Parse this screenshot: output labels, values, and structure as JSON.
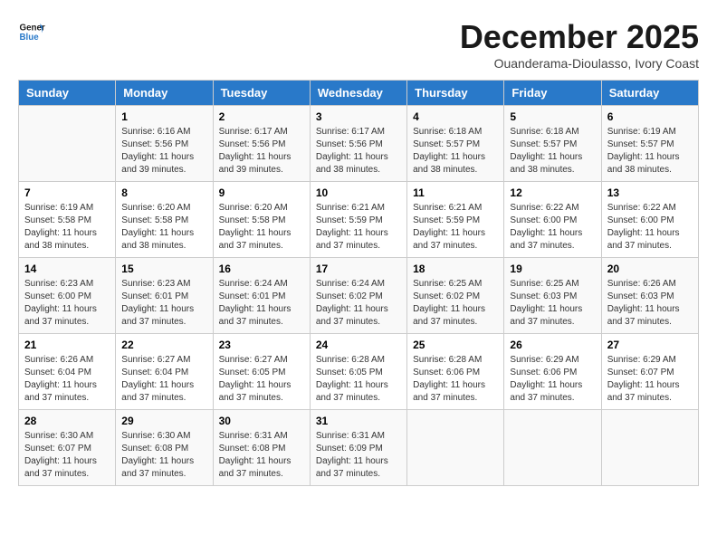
{
  "logo": {
    "line1": "General",
    "line2": "Blue"
  },
  "title": "December 2025",
  "subtitle": "Ouanderama-Dioulasso, Ivory Coast",
  "days_of_week": [
    "Sunday",
    "Monday",
    "Tuesday",
    "Wednesday",
    "Thursday",
    "Friday",
    "Saturday"
  ],
  "weeks": [
    [
      {
        "day": "",
        "info": ""
      },
      {
        "day": "1",
        "info": "Sunrise: 6:16 AM\nSunset: 5:56 PM\nDaylight: 11 hours\nand 39 minutes."
      },
      {
        "day": "2",
        "info": "Sunrise: 6:17 AM\nSunset: 5:56 PM\nDaylight: 11 hours\nand 39 minutes."
      },
      {
        "day": "3",
        "info": "Sunrise: 6:17 AM\nSunset: 5:56 PM\nDaylight: 11 hours\nand 38 minutes."
      },
      {
        "day": "4",
        "info": "Sunrise: 6:18 AM\nSunset: 5:57 PM\nDaylight: 11 hours\nand 38 minutes."
      },
      {
        "day": "5",
        "info": "Sunrise: 6:18 AM\nSunset: 5:57 PM\nDaylight: 11 hours\nand 38 minutes."
      },
      {
        "day": "6",
        "info": "Sunrise: 6:19 AM\nSunset: 5:57 PM\nDaylight: 11 hours\nand 38 minutes."
      }
    ],
    [
      {
        "day": "7",
        "info": "Sunrise: 6:19 AM\nSunset: 5:58 PM\nDaylight: 11 hours\nand 38 minutes."
      },
      {
        "day": "8",
        "info": "Sunrise: 6:20 AM\nSunset: 5:58 PM\nDaylight: 11 hours\nand 38 minutes."
      },
      {
        "day": "9",
        "info": "Sunrise: 6:20 AM\nSunset: 5:58 PM\nDaylight: 11 hours\nand 37 minutes."
      },
      {
        "day": "10",
        "info": "Sunrise: 6:21 AM\nSunset: 5:59 PM\nDaylight: 11 hours\nand 37 minutes."
      },
      {
        "day": "11",
        "info": "Sunrise: 6:21 AM\nSunset: 5:59 PM\nDaylight: 11 hours\nand 37 minutes."
      },
      {
        "day": "12",
        "info": "Sunrise: 6:22 AM\nSunset: 6:00 PM\nDaylight: 11 hours\nand 37 minutes."
      },
      {
        "day": "13",
        "info": "Sunrise: 6:22 AM\nSunset: 6:00 PM\nDaylight: 11 hours\nand 37 minutes."
      }
    ],
    [
      {
        "day": "14",
        "info": "Sunrise: 6:23 AM\nSunset: 6:00 PM\nDaylight: 11 hours\nand 37 minutes."
      },
      {
        "day": "15",
        "info": "Sunrise: 6:23 AM\nSunset: 6:01 PM\nDaylight: 11 hours\nand 37 minutes."
      },
      {
        "day": "16",
        "info": "Sunrise: 6:24 AM\nSunset: 6:01 PM\nDaylight: 11 hours\nand 37 minutes."
      },
      {
        "day": "17",
        "info": "Sunrise: 6:24 AM\nSunset: 6:02 PM\nDaylight: 11 hours\nand 37 minutes."
      },
      {
        "day": "18",
        "info": "Sunrise: 6:25 AM\nSunset: 6:02 PM\nDaylight: 11 hours\nand 37 minutes."
      },
      {
        "day": "19",
        "info": "Sunrise: 6:25 AM\nSunset: 6:03 PM\nDaylight: 11 hours\nand 37 minutes."
      },
      {
        "day": "20",
        "info": "Sunrise: 6:26 AM\nSunset: 6:03 PM\nDaylight: 11 hours\nand 37 minutes."
      }
    ],
    [
      {
        "day": "21",
        "info": "Sunrise: 6:26 AM\nSunset: 6:04 PM\nDaylight: 11 hours\nand 37 minutes."
      },
      {
        "day": "22",
        "info": "Sunrise: 6:27 AM\nSunset: 6:04 PM\nDaylight: 11 hours\nand 37 minutes."
      },
      {
        "day": "23",
        "info": "Sunrise: 6:27 AM\nSunset: 6:05 PM\nDaylight: 11 hours\nand 37 minutes."
      },
      {
        "day": "24",
        "info": "Sunrise: 6:28 AM\nSunset: 6:05 PM\nDaylight: 11 hours\nand 37 minutes."
      },
      {
        "day": "25",
        "info": "Sunrise: 6:28 AM\nSunset: 6:06 PM\nDaylight: 11 hours\nand 37 minutes."
      },
      {
        "day": "26",
        "info": "Sunrise: 6:29 AM\nSunset: 6:06 PM\nDaylight: 11 hours\nand 37 minutes."
      },
      {
        "day": "27",
        "info": "Sunrise: 6:29 AM\nSunset: 6:07 PM\nDaylight: 11 hours\nand 37 minutes."
      }
    ],
    [
      {
        "day": "28",
        "info": "Sunrise: 6:30 AM\nSunset: 6:07 PM\nDaylight: 11 hours\nand 37 minutes."
      },
      {
        "day": "29",
        "info": "Sunrise: 6:30 AM\nSunset: 6:08 PM\nDaylight: 11 hours\nand 37 minutes."
      },
      {
        "day": "30",
        "info": "Sunrise: 6:31 AM\nSunset: 6:08 PM\nDaylight: 11 hours\nand 37 minutes."
      },
      {
        "day": "31",
        "info": "Sunrise: 6:31 AM\nSunset: 6:09 PM\nDaylight: 11 hours\nand 37 minutes."
      },
      {
        "day": "",
        "info": ""
      },
      {
        "day": "",
        "info": ""
      },
      {
        "day": "",
        "info": ""
      }
    ]
  ]
}
